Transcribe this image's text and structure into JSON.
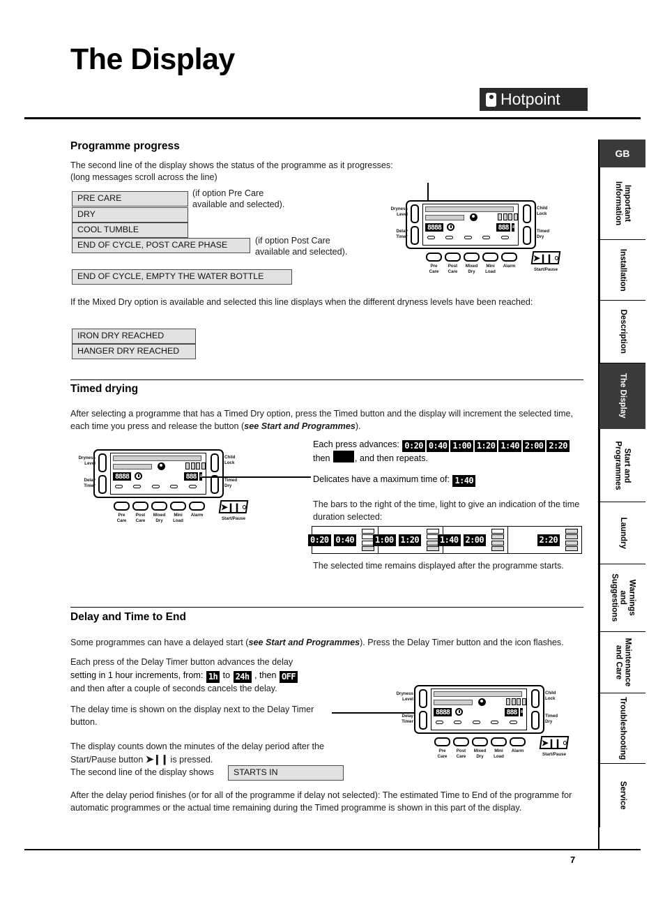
{
  "header": {
    "title": "The Display",
    "brand": "Hotpoint"
  },
  "sections": {
    "programme_progress": {
      "heading": "Programme progress",
      "intro_line1": "The second line of the display shows the status of the programme as it progresses:",
      "intro_line2": "(long messages scroll across the line)",
      "messages": [
        "PRE CARE",
        "DRY",
        "COOL TUMBLE",
        "END OF CYCLE, POST CARE PHASE",
        "END OF CYCLE, EMPTY THE WATER BOTTLE"
      ],
      "note_pre_line1": "(if option Pre Care",
      "note_pre_line2": "available and selected).",
      "note_post_line1": "(if option Post Care",
      "note_post_line2": "available and selected).",
      "mixed_dry_text": "If the Mixed Dry option is available and selected this line displays when the different dryness levels have been reached:",
      "mixed_dry_messages": [
        "IRON DRY REACHED",
        "HANGER DRY REACHED"
      ]
    },
    "timed_drying": {
      "heading": "Timed drying",
      "paragraph_1a": "After selecting a programme that has a Timed Dry option, press the Timed button and the display will increment the selected time, each time you press and release the button (",
      "paragraph_1_italic": "see Start and Programmes",
      "paragraph_1b": ").",
      "each_press_label": "Each press advances:",
      "each_press_values": [
        "0:20",
        "0:40",
        "1:00",
        "1:20",
        "1:40",
        "2:00",
        "2:20"
      ],
      "then_label": "then",
      "then_suffix": ", and then repeats.",
      "delicates_label": "Delicates have a maximum time of:",
      "delicates_value": "1:40",
      "bars_text": "The bars to the right of the time, light to give an indication of the time duration selected:",
      "bar_groups": [
        {
          "times": [
            "0:20",
            "0:40"
          ],
          "lit": 1
        },
        {
          "times": [
            "1:00",
            "1:20"
          ],
          "lit": 2
        },
        {
          "times": [
            "1:40",
            "2:00"
          ],
          "lit": 3
        },
        {
          "times": [
            "2:20"
          ],
          "lit": 4
        }
      ],
      "remains_text": "The selected time remains displayed after the programme starts."
    },
    "delay_time_to_end": {
      "heading": "Delay and Time to End",
      "para_1a": "Some programmes can have a delayed start (",
      "para_1_italic": "see Start and Programmes",
      "para_1b": "). Press the Delay Timer button and the icon flashes.",
      "para_2_line1": "Each press of the Delay Timer button advances the delay",
      "para_2_line2_pre": "setting in 1 hour increments, from:",
      "delay_from": "1h",
      "delay_to_label": "to",
      "delay_to": "24h",
      "delay_then_label": ", then",
      "delay_off": "OFF",
      "para_2_line3": "and then after a couple of seconds cancels the delay.",
      "para_3": "The delay time is shown on the display next to the Delay Timer button.",
      "para_4a": "The display counts down the minutes of the delay period after the Start/Pause button",
      "para_4b": "is pressed.",
      "para_5_pre": "The second line of the display shows",
      "starts_in": "STARTS IN",
      "para_6": "After the delay period finishes (or for all of the programme if delay not selected): The estimated Time to End of the programme for automatic programmes or the actual time remaining during the Timed programme is shown in this part of the display."
    }
  },
  "control_panel": {
    "left_labels": [
      {
        "line1": "Dryness",
        "line2": "Level"
      },
      {
        "line1": "Delay",
        "line2": "Timer"
      }
    ],
    "right_labels": [
      {
        "line1": "Child",
        "line2": "Lock"
      },
      {
        "line1": "Timed",
        "line2": "Dry"
      }
    ],
    "option_buttons": [
      {
        "line1": "Pre",
        "line2": "Care"
      },
      {
        "line1": "Post",
        "line2": "Care"
      },
      {
        "line1": "Mixed",
        "line2": "Dry"
      },
      {
        "line1": "Mini",
        "line2": "Load"
      },
      {
        "line1": "Alarm",
        "line2": ""
      }
    ],
    "start_pause_label": "Start/Pause",
    "seg_delay": "8888",
    "seg_time": "888"
  },
  "sidebar": {
    "language_tab": "GB",
    "tabs": [
      {
        "label": "Important Information",
        "active": false
      },
      {
        "label": "Installation",
        "active": false
      },
      {
        "label": "Description",
        "active": false
      },
      {
        "label": "The Display",
        "active": true
      },
      {
        "label": "Start and Programmes",
        "active": false
      },
      {
        "label": "Laundry",
        "active": false
      },
      {
        "label": "Warnings and Suggestions",
        "active": false
      },
      {
        "label": "Maintenance and Care",
        "active": false
      },
      {
        "label": "Troubleshooting",
        "active": false
      },
      {
        "label": "Service",
        "active": false
      }
    ]
  },
  "footer": {
    "page_number": "7"
  }
}
